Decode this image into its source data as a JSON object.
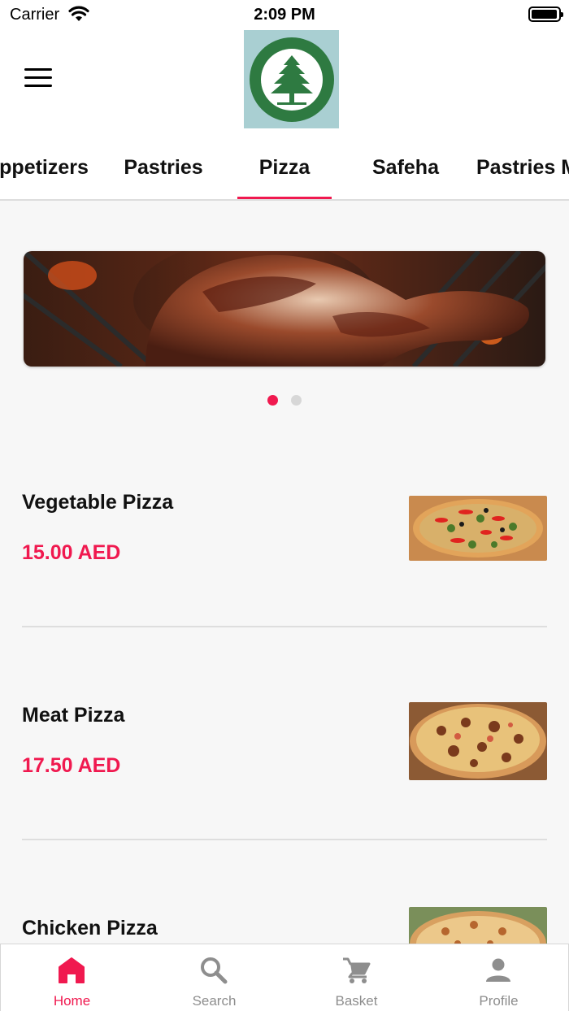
{
  "status_bar": {
    "carrier": "Carrier",
    "time": "2:09 PM"
  },
  "header": {
    "logo_icon": "cedar-tree-logo"
  },
  "tabs": [
    {
      "label": "Appetizers",
      "active": false
    },
    {
      "label": "Pastries",
      "active": false
    },
    {
      "label": "Pizza",
      "active": true
    },
    {
      "label": "Safeha",
      "active": false
    },
    {
      "label": "Pastries Mix",
      "active": false
    }
  ],
  "carousel": {
    "slide_count": 2,
    "active_index": 0
  },
  "menu_items": [
    {
      "name": "Vegetable Pizza",
      "price": "15.00 AED"
    },
    {
      "name": "Meat Pizza",
      "price": "17.50 AED"
    },
    {
      "name": "Chicken Pizza",
      "price": ""
    }
  ],
  "bottom_nav": {
    "home": "Home",
    "search": "Search",
    "basket": "Basket",
    "profile": "Profile"
  },
  "colors": {
    "accent": "#f0194f",
    "inactive": "#8e8e8e",
    "background": "#f7f7f7"
  }
}
